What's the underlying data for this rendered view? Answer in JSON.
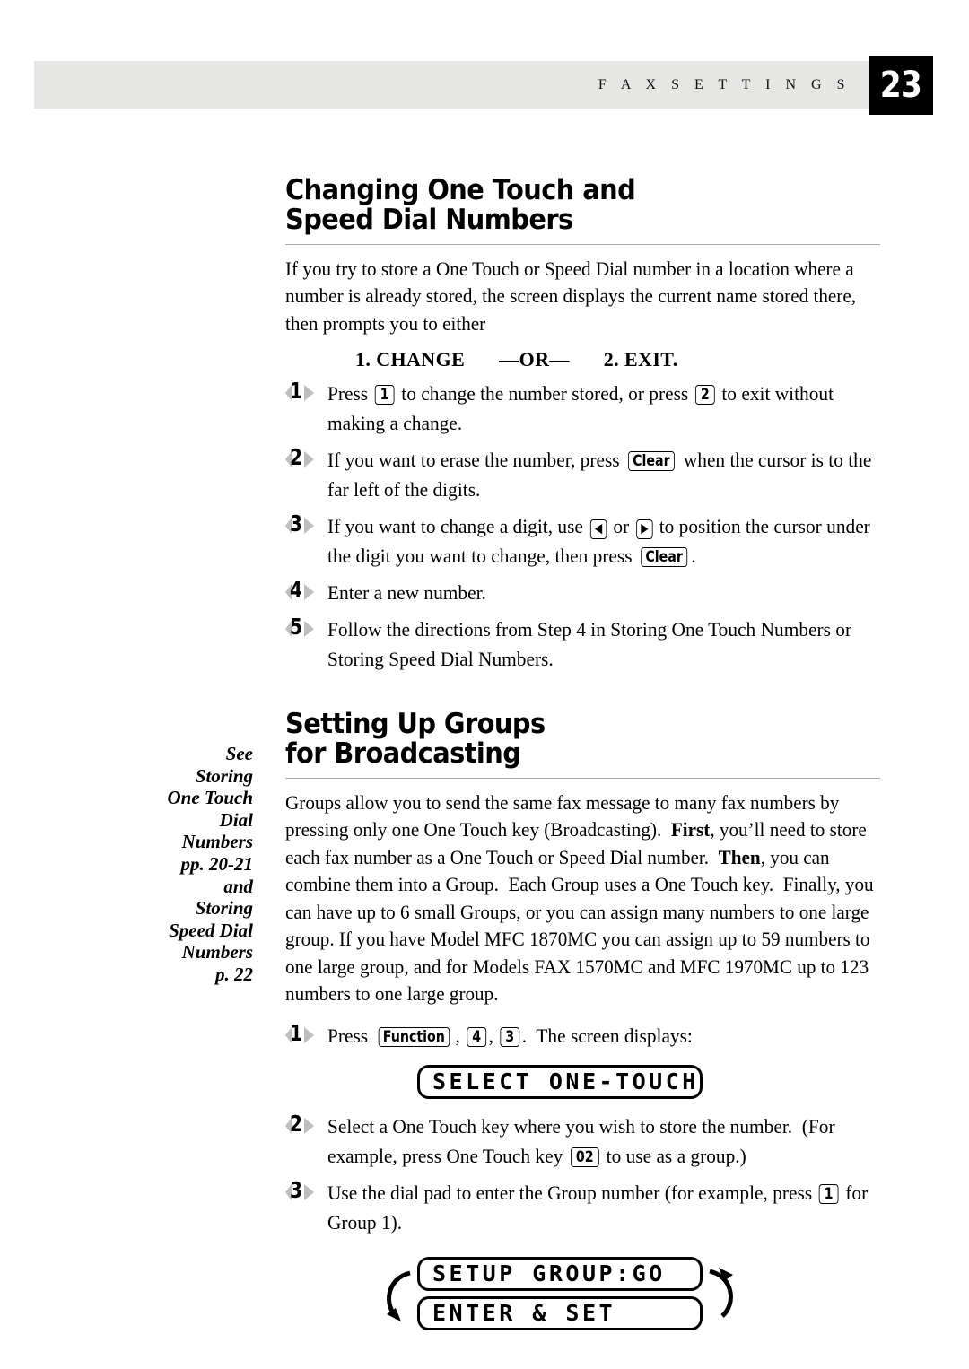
{
  "header": {
    "running_title": "F A X   S E T T I N G S",
    "page_number": "23"
  },
  "sections": [
    {
      "heading_line1": "Changing One Touch and",
      "heading_line2": "Speed Dial Numbers",
      "intro": "If you try to store a One Touch or Speed Dial number in a location where a number is already stored, the screen displays the current name stored there, then prompts you to either",
      "prompt": {
        "option1": "1. CHANGE",
        "separator": "—OR—",
        "option2": "2. EXIT."
      },
      "steps": {
        "s1_num": "1",
        "s1_a": "Press",
        "s1_key1": "1",
        "s1_b": "to change the number stored, or press",
        "s1_key2": "2",
        "s1_c": "to exit without making a change.",
        "s2_num": "2",
        "s2_a": "If you want to erase the number, press",
        "s2_key1": "Clear",
        "s2_b": "when the cursor is to the far left of the digits.",
        "s3_num": "3",
        "s3_a": "If you want to change a digit, use",
        "s3_key1": "◀",
        "s3_b": "or",
        "s3_key2": "▶",
        "s3_c": "to position the cursor under the digit you want to change, then press",
        "s3_key3": "Clear",
        "s3_d": ".",
        "s4_num": "4",
        "s4_a": "Enter a new number.",
        "s5_num": "5",
        "s5_a": "Follow the directions from Step 4 in Storing One Touch Numbers or Storing Speed Dial Numbers."
      }
    },
    {
      "heading_line1": "Setting Up Groups",
      "heading_line2": "for Broadcasting",
      "intro_p1": "Groups allow you to send the same fax message to many fax numbers by pressing only one One Touch key (Broadcasting).  ",
      "intro_b1": "First",
      "intro_p2": ", you’ll need to store each fax number as a One Touch or Speed Dial number.  ",
      "intro_b2": "Then",
      "intro_p3": ", you can combine them into a Group.  Each Group uses a One Touch key.  Finally, you can have up to 6 small Groups, or you can assign many numbers to one large group. If you have Model MFC 1870MC you can assign up to 59 numbers to one large group, and for Models FAX 1570MC and MFC 1970MC up to 123 numbers to one large group.",
      "margin_note": "See\nStoring\nOne Touch\nDial\nNumbers\npp. 20-21\nand\nStoring\nSpeed Dial\nNumbers\np. 22",
      "steps": {
        "g1_num": "1",
        "g1_a": "Press",
        "g1_key1": "Function",
        "g1_sep1": ",",
        "g1_key2": "4",
        "g1_sep2": ",",
        "g1_key3": "3",
        "g1_b": ".  The screen displays:",
        "g2_num": "2",
        "g2_a": "Select a One Touch key where you wish to store the number.  (For example, press One Touch key",
        "g2_key1": "02",
        "g2_b": "to use as a group.)",
        "g3_num": "3",
        "g3_a": "Use the dial pad to enter the Group number (for example, press",
        "g3_key1": "1",
        "g3_b": "for Group 1)."
      },
      "lcd": {
        "display1": "SELECT ONE-TOUCH",
        "display2": "SETUP GROUP:GO",
        "display3": "ENTER & SET"
      }
    }
  ],
  "colors": {
    "header_band": "#e6e6e4",
    "page_box": "#000000",
    "rule": "#a9a9a9",
    "marker_triangle": "#bfbfbf"
  }
}
